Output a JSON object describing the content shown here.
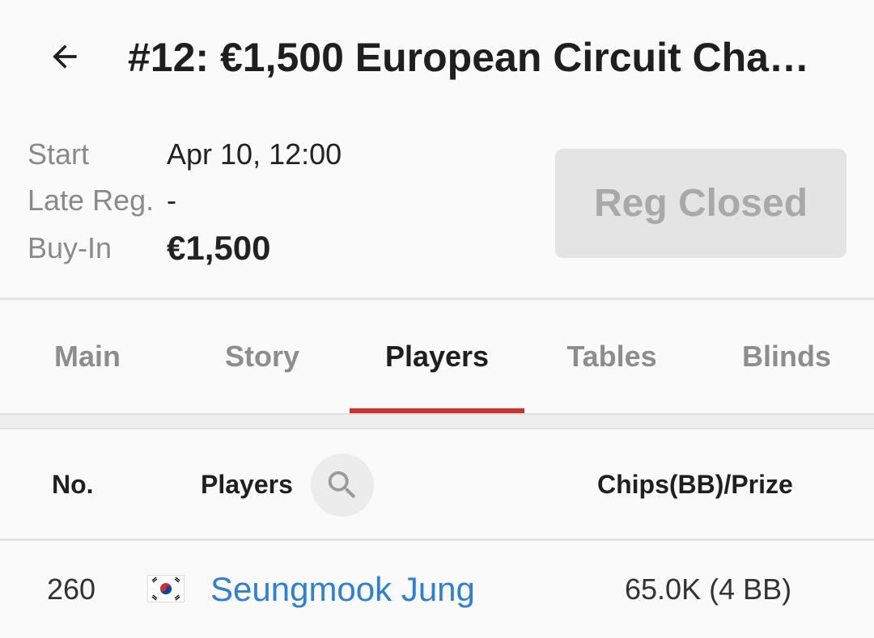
{
  "header": {
    "title": "#12: €1,500 European Circuit Cha…",
    "back_icon": "arrow-left-icon"
  },
  "info": {
    "start_label": "Start",
    "start_value": "Apr 10, 12:00",
    "late_reg_label": "Late Reg.",
    "late_reg_value": "-",
    "buyin_label": "Buy-In",
    "buyin_value": "€1,500",
    "reg_button": "Reg Closed"
  },
  "tabs": [
    {
      "label": "Main"
    },
    {
      "label": "Story"
    },
    {
      "label": "Players",
      "active": true
    },
    {
      "label": "Tables"
    },
    {
      "label": "Blinds"
    }
  ],
  "table": {
    "columns": {
      "no": "No.",
      "players": "Players",
      "chips": "Chips(BB)/Prize"
    },
    "search_icon": "search-icon",
    "rows": [
      {
        "no": "260",
        "flag": "south-korea-flag-icon",
        "name": "Seungmook Jung",
        "chips": "65.0K (4 BB)"
      }
    ]
  },
  "colors": {
    "accent": "#d32f2f",
    "link": "#2f7fd4",
    "disabled_button_bg": "#e4e4e4",
    "disabled_button_text": "#a9a9a9"
  }
}
